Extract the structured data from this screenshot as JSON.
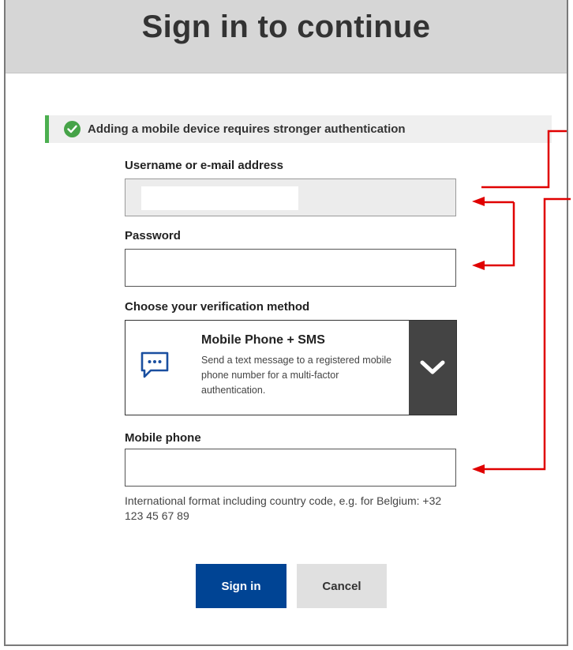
{
  "header": {
    "title": "Sign in to continue"
  },
  "notice": {
    "icon": "check-circle-icon",
    "text": "Adding a mobile device requires stronger authentication",
    "accent": "#4caf50"
  },
  "form": {
    "username": {
      "label": "Username or e-mail address",
      "value": ""
    },
    "password": {
      "label": "Password",
      "value": ""
    },
    "method": {
      "label": "Choose your verification method",
      "icon": "message-bubble-icon",
      "title": "Mobile Phone + SMS",
      "description": "Send a text message to a registered mobile phone number for a multi-factor authentication.",
      "dropdown_icon": "chevron-down-icon"
    },
    "mobile": {
      "label": "Mobile phone",
      "value": "",
      "hint": "International format including country code, e.g. for Belgium: +32 123 45 67 89"
    }
  },
  "buttons": {
    "sign_in": "Sign in",
    "cancel": "Cancel",
    "primary_color": "#004494"
  },
  "annotation": {
    "arrow_color": "#e00000"
  }
}
